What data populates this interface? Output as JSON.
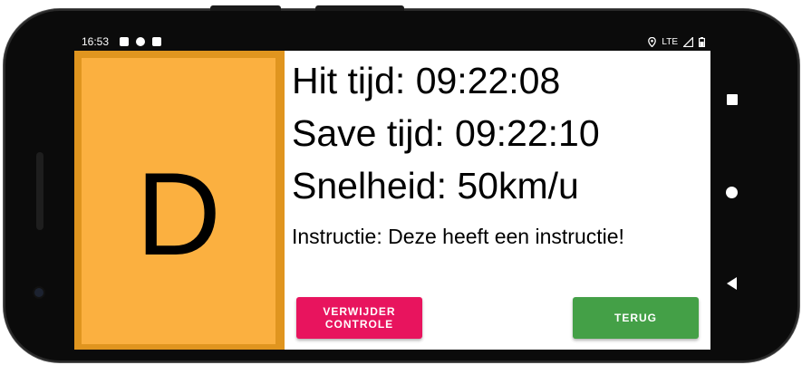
{
  "status_bar": {
    "time": "16:53",
    "network": "LTE",
    "icons": [
      "a-icon",
      "circle-app-icon",
      "sd-card-icon",
      "location-icon",
      "signal-icon",
      "battery-icon"
    ]
  },
  "detail": {
    "letter": "D",
    "hit_time": "Hit tijd: 09:22:08",
    "save_time": "Save tijd: 09:22:10",
    "speed": "Snelheid: 50km/u",
    "instruction": "Instructie: Deze heeft een instructie!"
  },
  "buttons": {
    "delete_label": "VERWIJDER CONTROLE",
    "back_label": "TERUG"
  },
  "colors": {
    "letter_panel": "#fbb040",
    "letter_panel_border": "#e0951f",
    "delete_button": "#e8145e",
    "back_button": "#44a047"
  }
}
